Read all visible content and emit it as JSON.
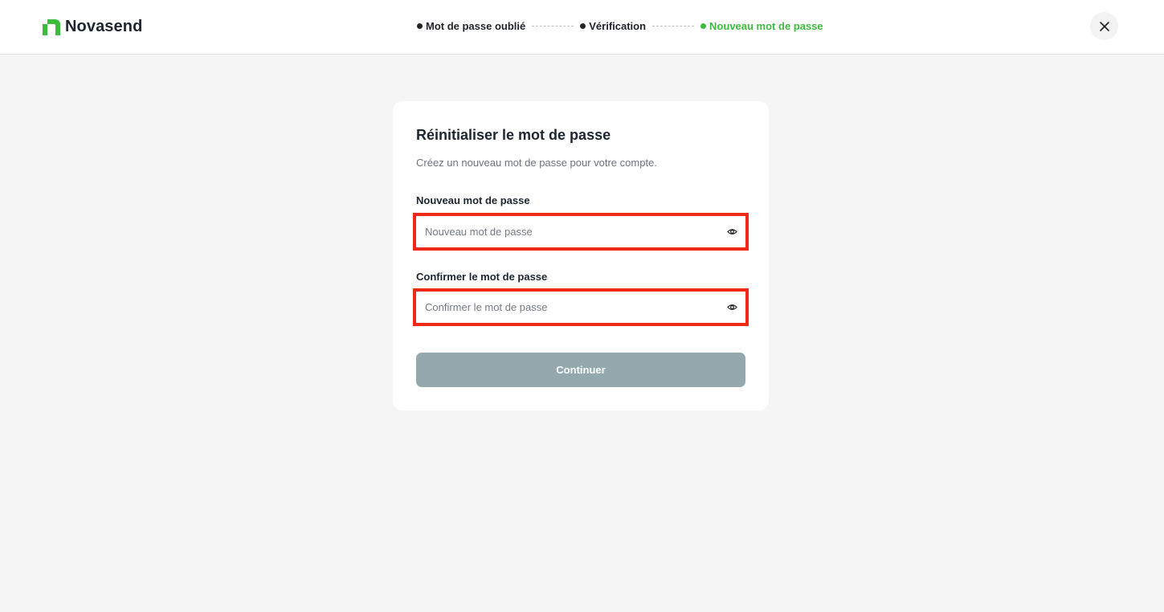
{
  "brand": {
    "name": "Novasend",
    "color": "#3dbb3d",
    "icon": "novasend-logo-icon"
  },
  "stepper": {
    "steps": [
      {
        "label": "Mot de passe oublié",
        "state": "done"
      },
      {
        "label": "Vérification",
        "state": "done"
      },
      {
        "label": "Nouveau mot de passe",
        "state": "active"
      }
    ],
    "active_color": "#3dbb3d"
  },
  "header": {
    "close_icon": "close-icon"
  },
  "form": {
    "title": "Réinitialiser le mot de passe",
    "subtitle": "Créez un nouveau mot de passe pour votre compte.",
    "new_password": {
      "label": "Nouveau mot de passe",
      "placeholder": "Nouveau mot de passe",
      "value": "",
      "icon": "eye-icon"
    },
    "confirm_password": {
      "label": "Confirmer le mot de passe",
      "placeholder": "Confirmer le mot de passe",
      "value": "",
      "icon": "eye-icon"
    },
    "submit_label": "Continuer",
    "submit_color": "#93a9ad",
    "highlight_color": "#ee2a17"
  }
}
